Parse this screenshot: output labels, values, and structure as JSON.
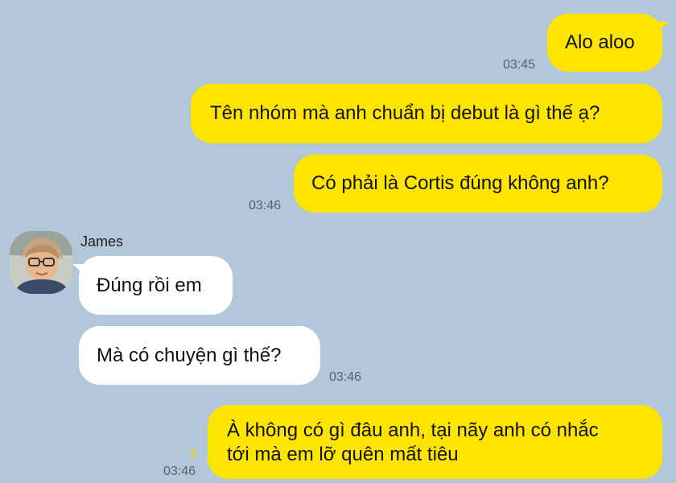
{
  "messages": {
    "m1": {
      "text": "Alo aloo",
      "time": "03:45"
    },
    "m2": {
      "text": "Tên nhóm mà anh chuẩn bị debut là gì thế ạ?"
    },
    "m3": {
      "text": "Có phải là Cortis đúng không anh?",
      "time": "03:46"
    },
    "m4": {
      "text": "Đúng rồi em"
    },
    "m5": {
      "text": "Mà có chuyện gì thế?",
      "time": "03:46"
    },
    "m6": {
      "line1": "À không có gì đâu anh, tại nãy anh có nhắc",
      "line2": "tới mà em lỡ quên mất tiêu",
      "time": "03:46",
      "unread": "1"
    }
  },
  "contact": {
    "name": "James",
    "avatar_icon": "profile-photo"
  },
  "colors": {
    "background": "#b2c7da",
    "my_bubble": "#fee500",
    "their_bubble": "#ffffff",
    "unread": "#f5d400"
  }
}
